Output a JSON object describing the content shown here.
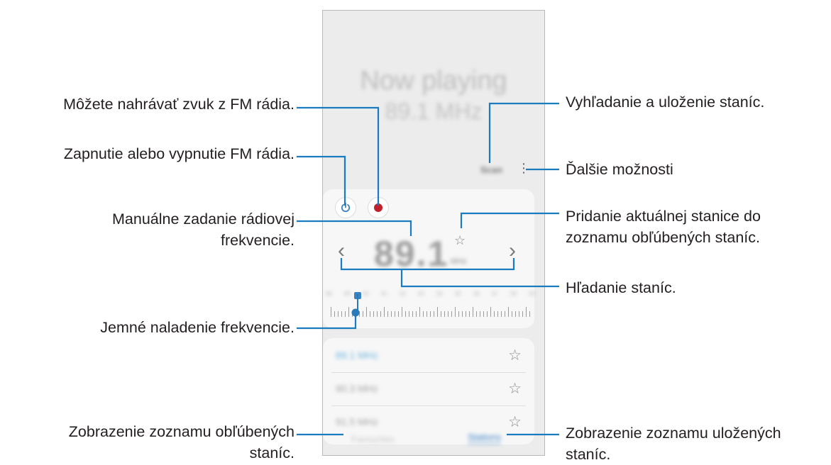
{
  "callouts": {
    "record": "Môžete nahrávať zvuk z FM rádia.",
    "power": "Zapnutie alebo vypnutie FM rádia.",
    "manual_1": "Manuálne zadanie rádiovej",
    "manual_2": "frekvencie.",
    "fine_tune": "Jemné naladenie frekvencie.",
    "view_fav_1": "Zobrazenie zoznamu obľúbených",
    "view_fav_2": "staníc.",
    "scan": "Vyhľadanie a uloženie staníc.",
    "more": "Ďalšie možnosti",
    "add_fav_1": "Pridanie aktuálnej stanice do",
    "add_fav_2": "zoznamu obľúbených staníc.",
    "search": "Hľadanie staníc.",
    "view_saved_1": "Zobrazenie zoznamu uložených",
    "view_saved_2": "staníc."
  },
  "phone": {
    "now_playing": "Now playing",
    "now_freq": "89.1 MHz",
    "scan_label": "Scan",
    "more_icon": "⋮",
    "big_freq": "89.1",
    "big_unit": "MHz",
    "scale": [
      "88",
      "89",
      "90",
      "91",
      "92",
      "93",
      "94",
      "95",
      "96",
      "97",
      "98",
      "99"
    ],
    "stations": [
      {
        "label": "89.1 MHz",
        "active": true
      },
      {
        "label": "90.3 MHz",
        "active": false
      },
      {
        "label": "91.5 MHz",
        "active": false
      }
    ],
    "tab_favourites": "Favourites",
    "tab_stations": "Stations",
    "accent": "#3b82c4",
    "record_color": "#c2212b"
  }
}
